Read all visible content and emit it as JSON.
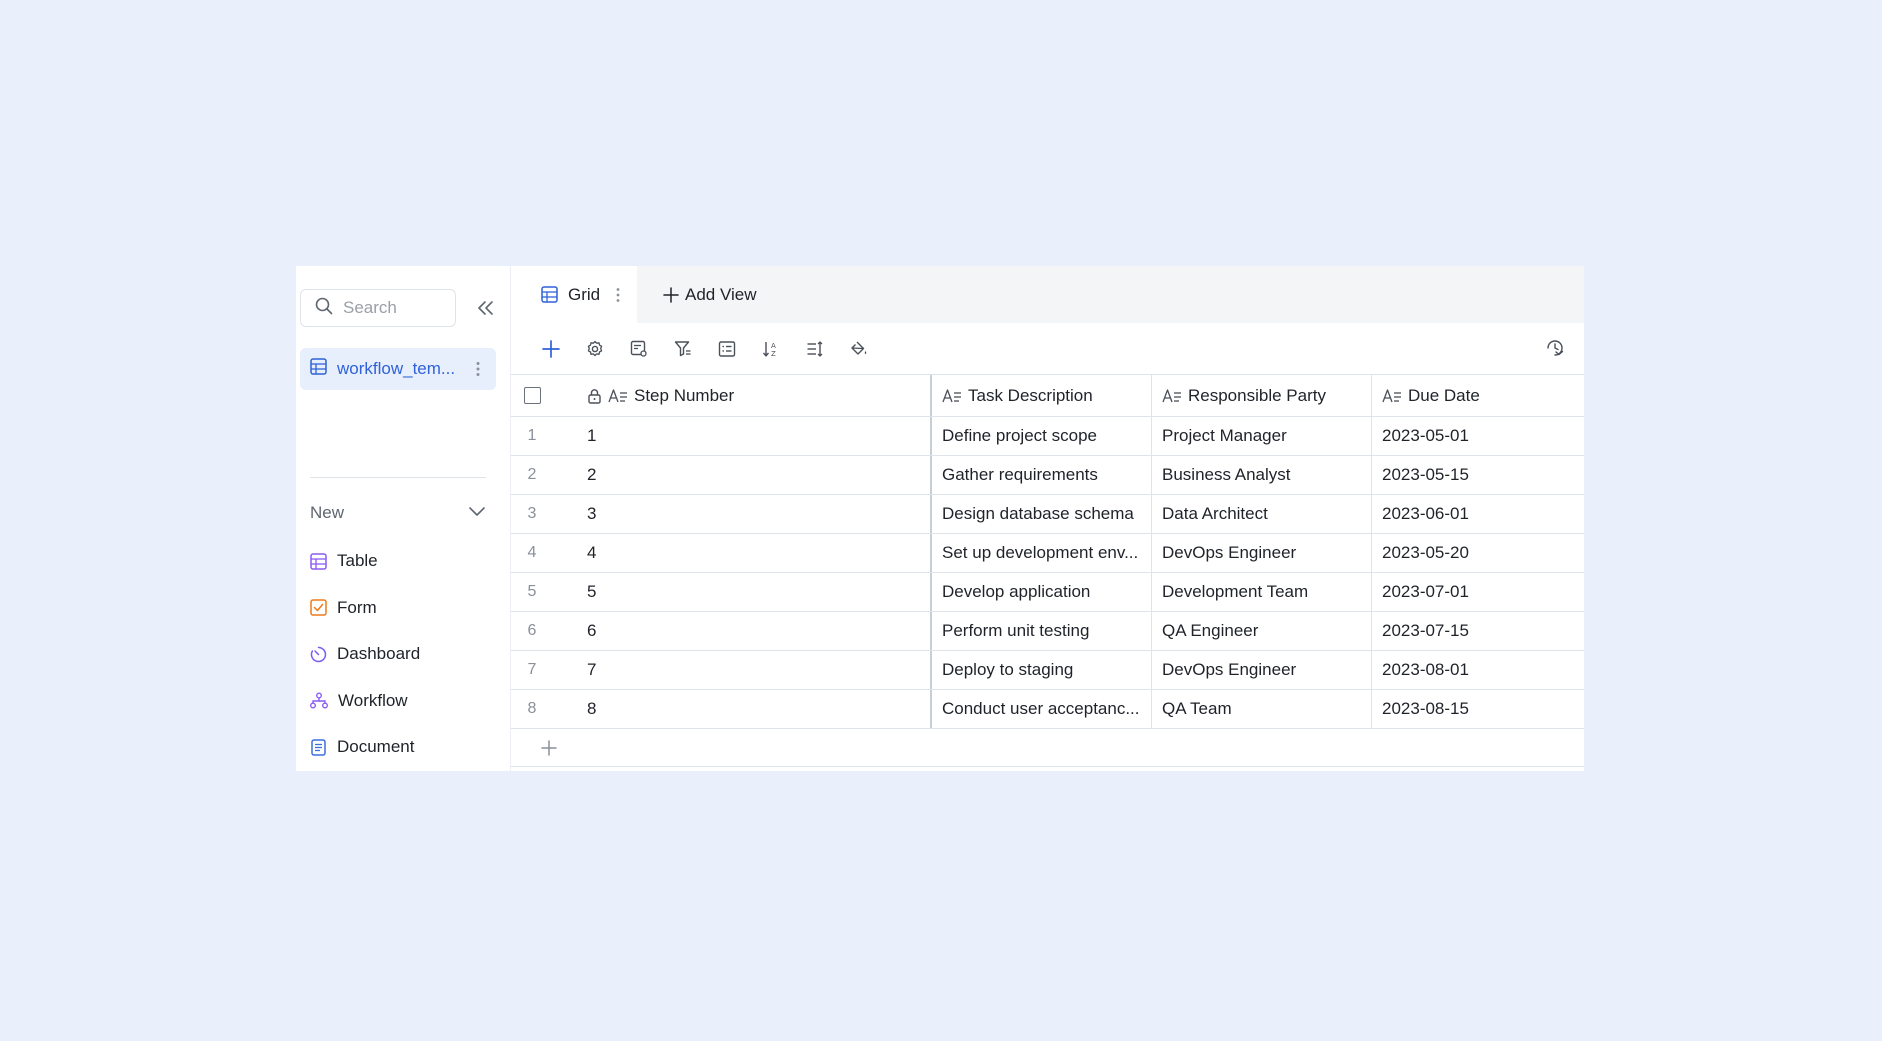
{
  "sidebar": {
    "search_placeholder": "Search",
    "table_name": "workflow_tem...",
    "new_label": "New",
    "create_items": [
      {
        "label": "Table",
        "icon": "table-icon",
        "color": "#8b5cf6"
      },
      {
        "label": "Form",
        "icon": "form-icon",
        "color": "#f07a1a"
      },
      {
        "label": "Dashboard",
        "icon": "dashboard-icon",
        "color": "#7b5cf0"
      },
      {
        "label": "Workflow",
        "icon": "workflow-icon",
        "color": "#8b5cf6"
      },
      {
        "label": "Document",
        "icon": "document-icon",
        "color": "#3b6fe0"
      }
    ]
  },
  "tabs": {
    "grid_label": "Grid",
    "add_view_label": "Add View"
  },
  "grid": {
    "columns": [
      "Step Number",
      "Task Description",
      "Responsible Party",
      "Due Date"
    ],
    "rows": [
      {
        "num": "1",
        "step": "1",
        "task": "Define project scope",
        "party": "Project Manager",
        "date": "2023-05-01"
      },
      {
        "num": "2",
        "step": "2",
        "task": "Gather requirements",
        "party": "Business Analyst",
        "date": "2023-05-15"
      },
      {
        "num": "3",
        "step": "3",
        "task": "Design database schema",
        "party": "Data Architect",
        "date": "2023-06-01"
      },
      {
        "num": "4",
        "step": "4",
        "task": "Set up development env...",
        "party": "DevOps Engineer",
        "date": "2023-05-20"
      },
      {
        "num": "5",
        "step": "5",
        "task": "Develop application",
        "party": "Development Team",
        "date": "2023-07-01"
      },
      {
        "num": "6",
        "step": "6",
        "task": "Perform unit testing",
        "party": "QA Engineer",
        "date": "2023-07-15"
      },
      {
        "num": "7",
        "step": "7",
        "task": "Deploy to staging",
        "party": "DevOps Engineer",
        "date": "2023-08-01"
      },
      {
        "num": "8",
        "step": "8",
        "task": "Conduct user acceptanc...",
        "party": "QA Team",
        "date": "2023-08-15"
      }
    ]
  },
  "colors": {
    "background": "#e9effb",
    "accent": "#2f62d9",
    "selected_bg": "#e7eefc"
  }
}
